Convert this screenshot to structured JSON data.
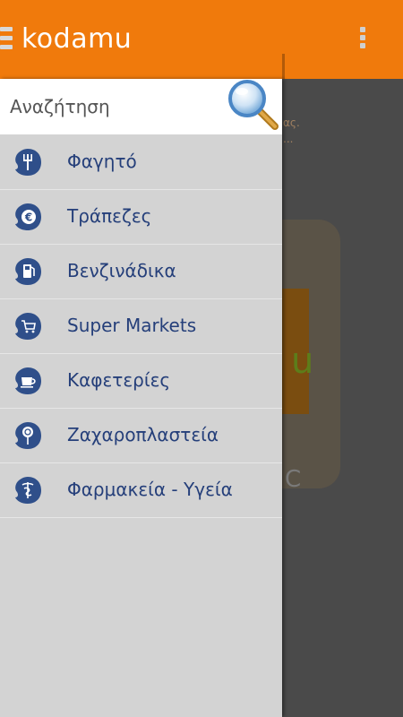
{
  "app": {
    "title": "kodamu"
  },
  "search": {
    "placeholder": "Αναζήτηση"
  },
  "menu": {
    "items": [
      {
        "label": "Φαγητό",
        "icon": "fork-icon"
      },
      {
        "label": "Τράπεζες",
        "icon": "euro-icon"
      },
      {
        "label": "Βενζινάδικα",
        "icon": "fuel-pump-icon"
      },
      {
        "label": "Super Markets",
        "icon": "cart-icon"
      },
      {
        "label": "Καφετερίες",
        "icon": "coffee-cup-icon"
      },
      {
        "label": "Ζαχαροπλαστεία",
        "icon": "lollipop-icon"
      },
      {
        "label": "Φαρμακεία - Υγεία",
        "icon": "caduceus-icon"
      }
    ]
  },
  "background": {
    "partial_text_1": "ας.",
    "partial_text_2": "...",
    "partial_letter": "u",
    "partial_letter_2": "C"
  },
  "colors": {
    "appbar": "#f07a0c",
    "drawer": "#d3d3d3",
    "label": "#253f7a",
    "icon_blob": "#2f4f8a"
  }
}
